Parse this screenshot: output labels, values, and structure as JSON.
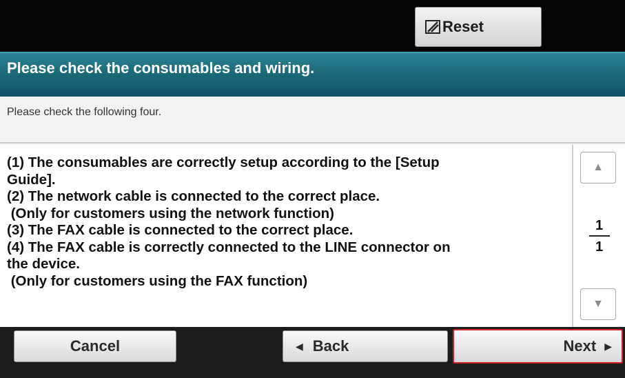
{
  "header": {
    "reset_label": "Reset",
    "reset_icon": "reset-icon"
  },
  "title": "Please check the consumables and wiring.",
  "instruction": "Please check the following four.",
  "message": "(1) The consumables are correctly setup according to the [Setup\nGuide].\n(2) The network cable is connected to the correct place.\n (Only for customers using the network function)\n(3) The FAX cable is connected to the correct place.\n(4) The FAX cable is correctly connected to the LINE connector on\nthe device.\n (Only for customers using the FAX function)",
  "pager": {
    "up_icon": "▲",
    "down_icon": "▼",
    "current": "1",
    "total": "1"
  },
  "footer": {
    "cancel_label": "Cancel",
    "back_label": "Back",
    "back_icon": "◀",
    "next_label": "Next",
    "next_icon": "▶"
  },
  "colors": {
    "title_band": "#1b6a7a",
    "next_highlight": "#d3212c"
  }
}
